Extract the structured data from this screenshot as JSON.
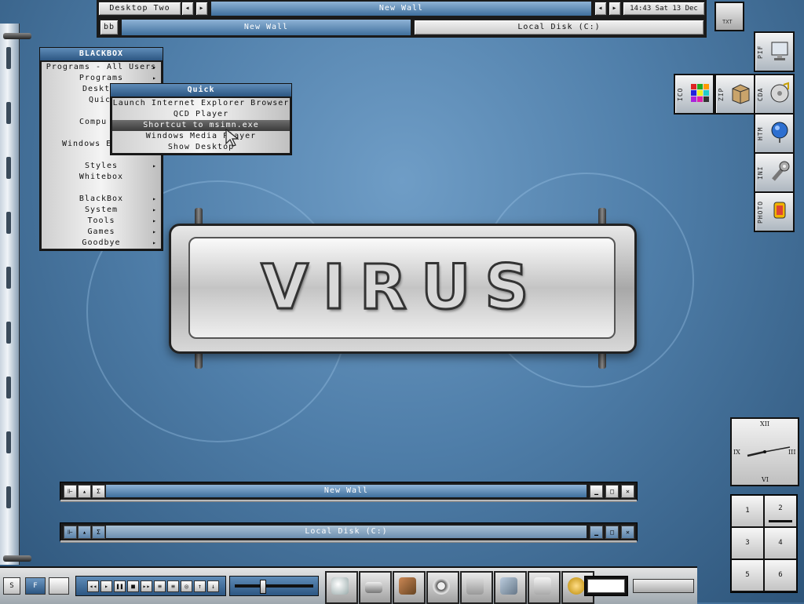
{
  "toolbar": {
    "workspace_label": "Desktop Two",
    "window_label": "New Wall",
    "clock_text": "14:43 Sat 13 Dec",
    "prev_label": "◂",
    "next_label": "▸"
  },
  "taskbar_top": {
    "bb_button": "bb",
    "tasks": [
      "New Wall",
      "Local Disk (C:)"
    ]
  },
  "blackbox_menu": {
    "title": "BLACKBOX",
    "items": [
      {
        "label": "Programs - All Users",
        "submenu": true
      },
      {
        "label": "Programs",
        "submenu": true
      },
      {
        "label": "Deskt",
        "submenu": false
      },
      {
        "label": "Quick",
        "submenu": false
      },
      {
        "label": "Compu",
        "submenu": false
      },
      {
        "label": "Windows E",
        "submenu": false
      },
      {
        "label": "Styles",
        "submenu": true
      },
      {
        "label": "Whitebox",
        "submenu": false
      },
      {
        "label": "BlackBox",
        "submenu": true
      },
      {
        "label": "System",
        "submenu": true
      },
      {
        "label": "Tools",
        "submenu": true
      },
      {
        "label": "Games",
        "submenu": true
      },
      {
        "label": "Goodbye",
        "submenu": true
      }
    ]
  },
  "quick_menu": {
    "title": "Quick",
    "items": [
      "Launch Internet Explorer Browser",
      "QCD Player",
      "Shortcut to msimn.exe",
      "Windows Media Player",
      "Show Desktop"
    ],
    "selected_index": 2
  },
  "desktop_icons": {
    "right_column": [
      "PIF",
      "CDA",
      "HTM",
      "INI",
      "PHOTO"
    ],
    "top_row": [
      "ICO",
      "ZIP"
    ],
    "corner": "TXT"
  },
  "logo_text": "VIRUS",
  "clock": {
    "numerals": [
      "XII",
      "III",
      "VI",
      "IX"
    ]
  },
  "pager": {
    "desktops": [
      "1",
      "2",
      "3",
      "4",
      "5",
      "6"
    ],
    "active": "2"
  },
  "windows": [
    {
      "title": "New Wall"
    },
    {
      "title": "Local Disk (C:)"
    }
  ],
  "bottom_bar": {
    "left_buttons": [
      "S",
      "F",
      ""
    ],
    "media_controls": [
      "◂◂",
      "▸",
      "❚❚",
      "■",
      "▸▸",
      "≡",
      "≡",
      "◎",
      "↑",
      "↓"
    ],
    "volume_level": 0.35,
    "apps": [
      "mouse",
      "drive",
      "tools",
      "film",
      "folder",
      "window",
      "cards",
      "power"
    ]
  },
  "colors": {
    "desktop_blue": "#4f7ea9",
    "titlebar_blue": "#3f6f9c",
    "menu_highlight": "#3a3a3a"
  }
}
